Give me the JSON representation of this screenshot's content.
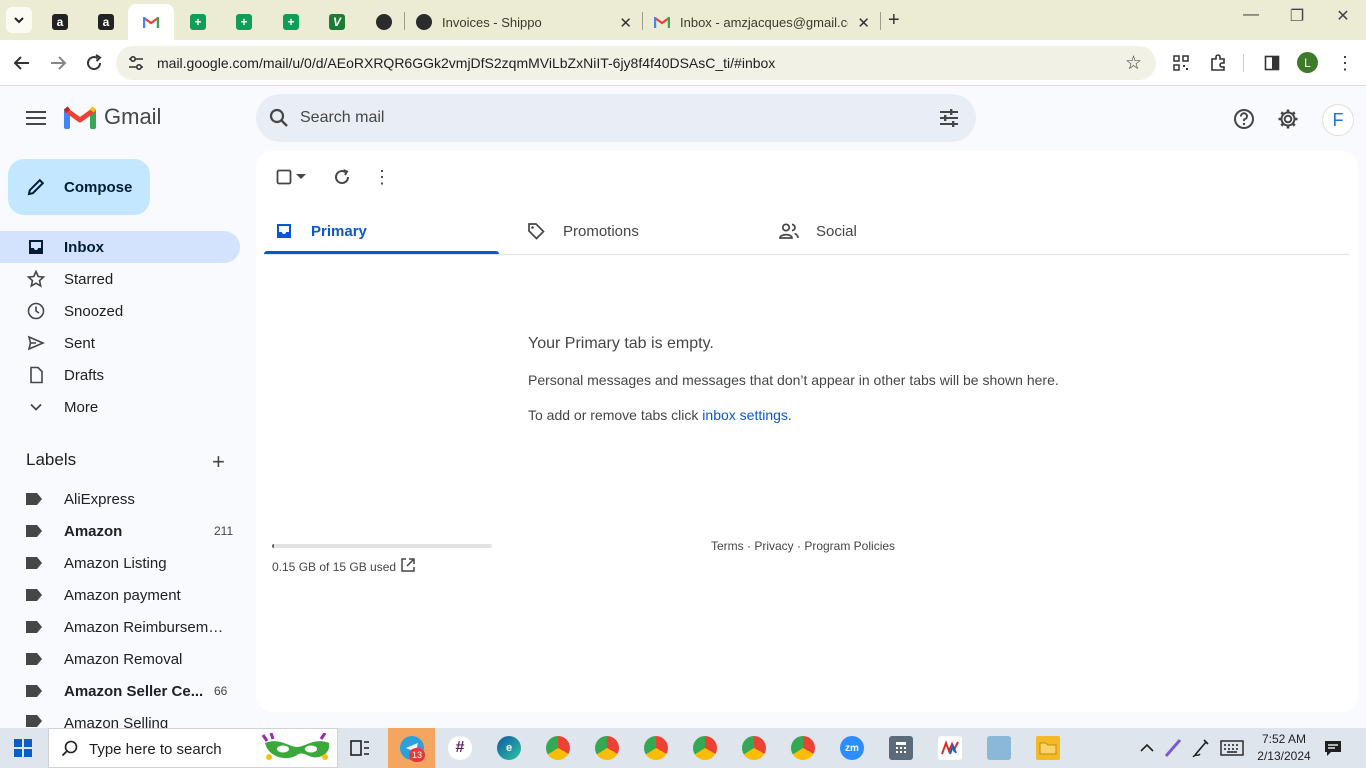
{
  "browser": {
    "tabs": [
      {
        "id": "amazon-1",
        "letter": "a"
      },
      {
        "id": "amazon-2",
        "letter": "a"
      },
      {
        "id": "gmail-active"
      },
      {
        "id": "sheets-1"
      },
      {
        "id": "sheets-2"
      },
      {
        "id": "sheets-3"
      },
      {
        "id": "vaughn"
      },
      {
        "id": "shippo-globe"
      },
      {
        "title": "Invoices - Shippo"
      },
      {
        "title": "Inbox - amzjacques@gmail.com"
      }
    ],
    "url": "mail.google.com/mail/u/0/d/AEoRXRQR6GGk2vmjDfS2zqmMViLbZxNiIT-6jy8f4f40DSAsC_ti/#inbox",
    "profile_initial": "L"
  },
  "gmail": {
    "logo_text": "Gmail",
    "search_placeholder": "Search mail",
    "avatar_initial": "F",
    "compose_label": "Compose",
    "nav": [
      {
        "label": "Inbox",
        "icon": "inbox-icon",
        "active": true
      },
      {
        "label": "Starred",
        "icon": "star-icon"
      },
      {
        "label": "Snoozed",
        "icon": "clock-icon"
      },
      {
        "label": "Sent",
        "icon": "send-icon"
      },
      {
        "label": "Drafts",
        "icon": "draft-icon"
      },
      {
        "label": "More",
        "icon": "chevron-down-icon"
      }
    ],
    "labels_heading": "Labels",
    "labels": [
      {
        "name": "AliExpress",
        "count": ""
      },
      {
        "name": "Amazon",
        "count": "211",
        "bold": true
      },
      {
        "name": "Amazon Listing",
        "count": ""
      },
      {
        "name": "Amazon payment",
        "count": ""
      },
      {
        "name": "Amazon Reimbursemen...",
        "count": ""
      },
      {
        "name": "Amazon Removal",
        "count": ""
      },
      {
        "name": "Amazon Seller Ce...",
        "count": "66",
        "bold": true
      },
      {
        "name": "Amazon Selling",
        "count": ""
      }
    ],
    "category_tabs": [
      {
        "label": "Primary",
        "icon": "inbox-icon",
        "active": true
      },
      {
        "label": "Promotions",
        "icon": "tag-icon"
      },
      {
        "label": "Social",
        "icon": "people-icon"
      }
    ],
    "empty_title": "Your Primary tab is empty.",
    "empty_sub": "Personal messages and messages that don’t appear in other tabs will be shown here.",
    "empty_link_prefix": "To add or remove tabs click ",
    "empty_link": "inbox settings",
    "empty_link_suffix": ".",
    "storage_text": "0.15 GB of 15 GB used",
    "storage_fraction": 0.01,
    "footer_links": "Terms · Privacy · Program Policies"
  },
  "taskbar": {
    "search_placeholder": "Type here to search",
    "telegram_badge": "13",
    "time": "7:52 AM",
    "date": "2/13/2024"
  }
}
